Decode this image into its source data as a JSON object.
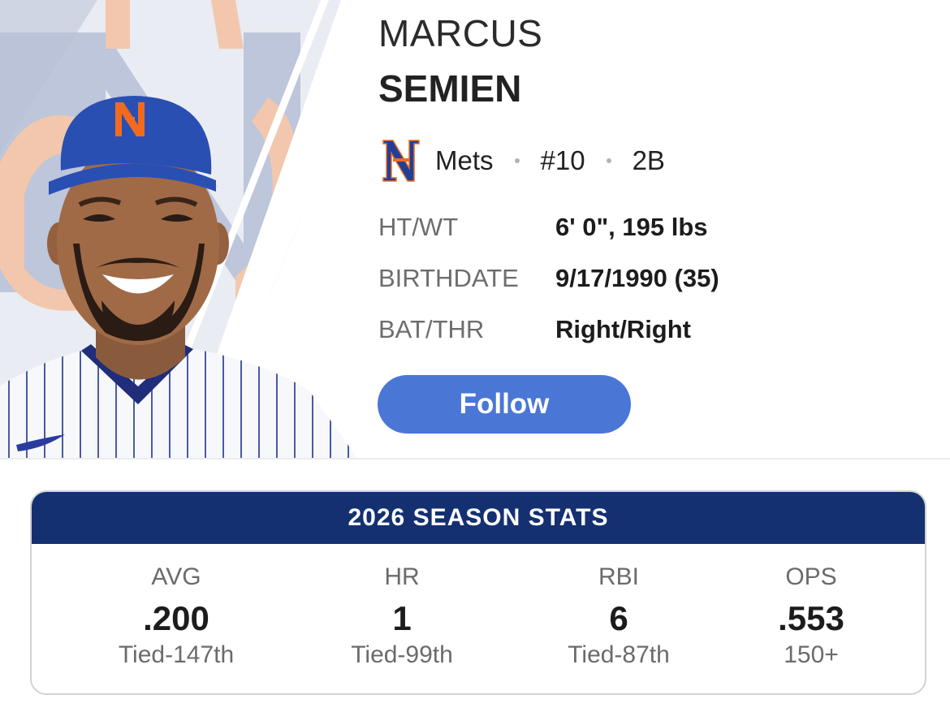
{
  "player": {
    "first_name": "MARCUS",
    "last_name": "SEMIEN",
    "team": "Mets",
    "number": "#10",
    "position": "2B"
  },
  "bio": {
    "rows": [
      {
        "label": "HT/WT",
        "value": "6' 0\", 195 lbs"
      },
      {
        "label": "BIRTHDATE",
        "value": "9/17/1990 (35)"
      },
      {
        "label": "BAT/THR",
        "value": "Right/Right"
      }
    ]
  },
  "actions": {
    "follow_label": "Follow"
  },
  "stats": {
    "title": "2026 SEASON STATS",
    "items": [
      {
        "label": "AVG",
        "value": ".200",
        "rank": "Tied-147th"
      },
      {
        "label": "HR",
        "value": "1",
        "rank": "Tied-99th"
      },
      {
        "label": "RBI",
        "value": "6",
        "rank": "Tied-87th"
      },
      {
        "label": "OPS",
        "value": ".553",
        "rank": "150+"
      }
    ]
  },
  "icons": {
    "team_logo": "mets-ny-logo",
    "cap_logo": "mets-ny-logo",
    "photo": "player-headshot"
  },
  "colors": {
    "follow_button": "#4a76d6",
    "stats_header": "#143071",
    "mets_blue": "#2a4fb3",
    "mets_orange": "#f06b1e",
    "bg_logo_blue": "#b9c2d8",
    "bg_logo_orange": "#f3c4a6"
  }
}
